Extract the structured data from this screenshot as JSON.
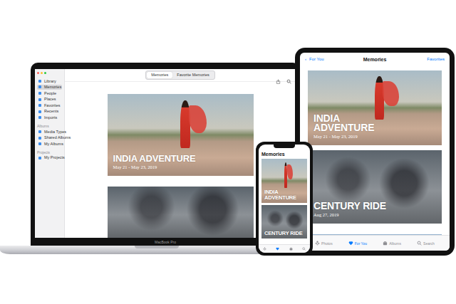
{
  "laptop": {
    "brand": "MacBook Pro",
    "sidebar": {
      "items": [
        {
          "label": "Library",
          "selected": false
        },
        {
          "label": "Memories",
          "selected": true
        },
        {
          "label": "People",
          "selected": false
        },
        {
          "label": "Places",
          "selected": false
        },
        {
          "label": "Favorites",
          "selected": false
        },
        {
          "label": "Recents",
          "selected": false
        },
        {
          "label": "Imports",
          "selected": false
        }
      ],
      "sections": [
        {
          "title": "Albums",
          "items": [
            {
              "label": "Media Types",
              "selected": false
            },
            {
              "label": "Shared Albums",
              "selected": false
            },
            {
              "label": "My Albums",
              "selected": false
            }
          ]
        },
        {
          "title": "Projects",
          "items": [
            {
              "label": "My Projects",
              "selected": false
            }
          ]
        }
      ]
    },
    "toolbar": {
      "segments": [
        {
          "label": "Memories",
          "selected": true
        },
        {
          "label": "Favorite Memories",
          "selected": false
        }
      ]
    },
    "memories": [
      {
        "kind": "titled",
        "title": "INDIA ADVENTURE",
        "date": "May 21 - May 23, 2019"
      },
      {
        "kind": "untitled"
      }
    ]
  },
  "tablet": {
    "nav": {
      "back_icon": "‹",
      "back": "For You",
      "title": "Memories",
      "action": "Favorites"
    },
    "memories": [
      {
        "kind": "titled",
        "title": "INDIA ADVENTURE",
        "date": "May 21 - May 23, 2019"
      },
      {
        "kind": "titled",
        "title": "CENTURY RIDE",
        "date": "Aug 27, 2019"
      },
      {
        "kind": "untitled"
      }
    ],
    "tabs": [
      {
        "label": "Photos",
        "selected": false
      },
      {
        "label": "For You",
        "selected": true
      },
      {
        "label": "Albums",
        "selected": false
      },
      {
        "label": "Search",
        "selected": false
      }
    ]
  },
  "phone": {
    "title": "Memories",
    "memories": [
      {
        "kind": "titled",
        "title": "INDIA ADVENTURE"
      },
      {
        "kind": "titled",
        "title": "CENTURY RIDE"
      }
    ],
    "tabs": [
      {
        "selected": false
      },
      {
        "selected": true
      },
      {
        "selected": false
      },
      {
        "selected": false
      }
    ]
  }
}
